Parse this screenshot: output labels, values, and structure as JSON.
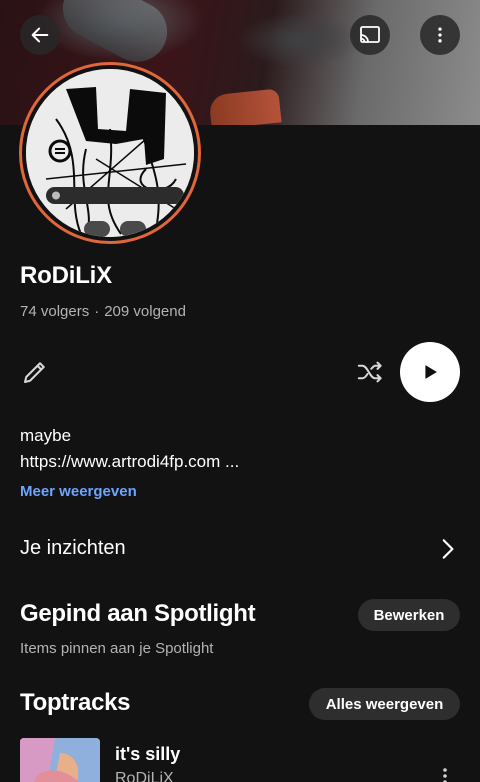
{
  "profile": {
    "name": "RoDiLiX",
    "followers": "74 volgers",
    "separator": "·",
    "following": "209 volgend",
    "bio_line1": "maybe",
    "bio_line2": "https://www.artrodi4fp.com ...",
    "show_more": "Meer weergeven"
  },
  "insights": {
    "label": "Je inzichten"
  },
  "spotlight": {
    "title": "Gepind aan Spotlight",
    "edit_label": "Bewerken",
    "subtitle": "Items pinnen aan je Spotlight"
  },
  "top_tracks": {
    "title": "Toptracks",
    "show_all": "Alles weergeven",
    "items": [
      {
        "title": "it's silly",
        "artist": "RoDiLiX"
      }
    ]
  },
  "icons": {
    "back": "arrow-left-icon",
    "cast": "cast-icon",
    "more": "more-vertical-icon",
    "edit": "pencil-icon",
    "shuffle": "shuffle-icon",
    "play": "play-icon",
    "chevron": "chevron-right-icon"
  },
  "colors": {
    "background": "#121212",
    "avatar_ring": "#e0663b",
    "link": "#6ea4ff",
    "pill": "#2e2e2e"
  }
}
